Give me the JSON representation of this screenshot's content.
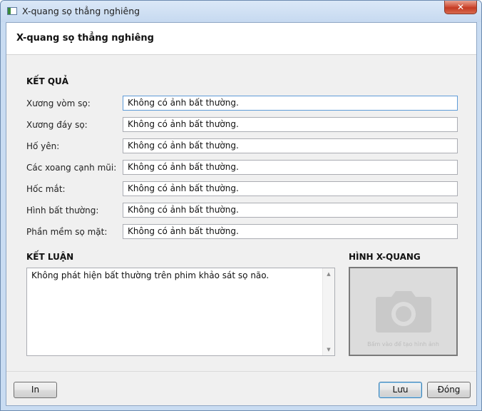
{
  "window": {
    "title": "X-quang sọ thẳng nghiêng",
    "close_glyph": "✕"
  },
  "header": {
    "title": "X-quang sọ thẳng nghiêng"
  },
  "results": {
    "title": "KẾT QUẢ",
    "fields": [
      {
        "label": "Xương vòm sọ:",
        "value": "Không có ảnh bất thường."
      },
      {
        "label": "Xương đáy sọ:",
        "value": "Không có ảnh bất thường."
      },
      {
        "label": "Hố yên:",
        "value": "Không có ảnh bất thường."
      },
      {
        "label": "Các xoang cạnh mũi:",
        "value": "Không có ảnh bất thường."
      },
      {
        "label": "Hốc mắt:",
        "value": "Không có ảnh bất thường."
      },
      {
        "label": "Hình bất thường:",
        "value": "Không có ảnh bất thường."
      },
      {
        "label": "Phần mềm sọ mặt:",
        "value": "Không có ảnh bất thường."
      }
    ]
  },
  "conclusion": {
    "title": "KẾT LUẬN",
    "text": "Không phát hiện bất thường trên phim khảo sát sọ não."
  },
  "image": {
    "title": "HÌNH X-QUANG",
    "hint": "Bấm vào để tạo hình ảnh",
    "icon": "camera-icon"
  },
  "buttons": {
    "print": "In",
    "save": "Lưu",
    "close": "Đóng"
  },
  "colors": {
    "title_bar": "#c6d9f0",
    "close_button": "#c43a22",
    "panel": "#f0f0f0",
    "focus_border": "#5e9bd8"
  }
}
